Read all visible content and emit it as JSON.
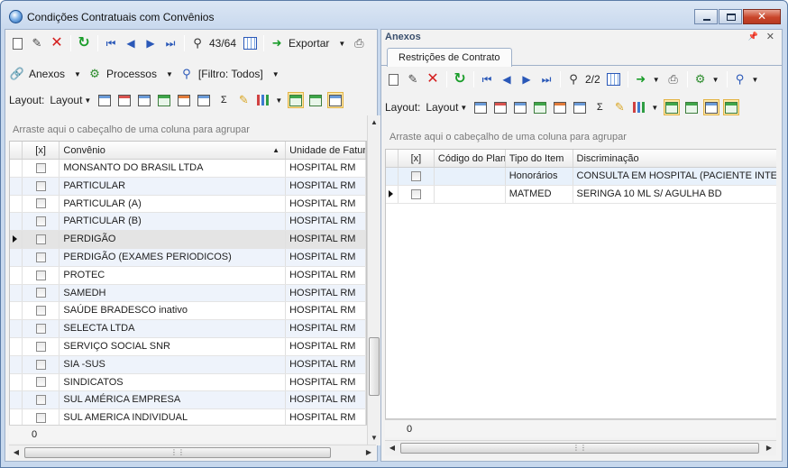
{
  "window": {
    "title": "Condições Contratuais com Convênios",
    "close_glyph": "✕"
  },
  "left": {
    "toolbar1": {
      "record_position": "43/64",
      "export_label": "Exportar"
    },
    "toolbar2": {
      "anexos_label": "Anexos",
      "processos_label": "Processos",
      "filter_label": "[Filtro: Todos]"
    },
    "toolbar3": {
      "layout_label": "Layout:",
      "layout_menu": "Layout"
    },
    "group_hint": "Arraste aqui o cabeçalho de uma coluna para agrupar",
    "columns": {
      "check": "[x]",
      "convenio": "Convênio",
      "unidade": "Unidade de Fatura"
    },
    "rows": [
      {
        "convenio": "MONSANTO DO BRASIL LTDA",
        "unidade": "HOSPITAL RM"
      },
      {
        "convenio": "PARTICULAR",
        "unidade": "HOSPITAL RM"
      },
      {
        "convenio": "PARTICULAR (A)",
        "unidade": "HOSPITAL RM"
      },
      {
        "convenio": "PARTICULAR (B)",
        "unidade": "HOSPITAL RM"
      },
      {
        "convenio": "PERDIGÃO",
        "unidade": "HOSPITAL RM"
      },
      {
        "convenio": "PERDIGÃO (EXAMES PERIODICOS)",
        "unidade": "HOSPITAL RM"
      },
      {
        "convenio": "PROTEC",
        "unidade": "HOSPITAL RM"
      },
      {
        "convenio": "SAMEDH",
        "unidade": "HOSPITAL RM"
      },
      {
        "convenio": "SAÚDE BRADESCO inativo",
        "unidade": "HOSPITAL RM"
      },
      {
        "convenio": "SELECTA LTDA",
        "unidade": "HOSPITAL RM"
      },
      {
        "convenio": "SERVIÇO SOCIAL SNR",
        "unidade": "HOSPITAL RM"
      },
      {
        "convenio": "SIA -SUS",
        "unidade": "HOSPITAL RM"
      },
      {
        "convenio": "SINDICATOS",
        "unidade": "HOSPITAL RM"
      },
      {
        "convenio": "SUL AMÉRICA EMPRESA",
        "unidade": "HOSPITAL RM"
      },
      {
        "convenio": "SUL AMERICA INDIVIDUAL",
        "unidade": "HOSPITAL RM"
      }
    ],
    "footer_count": "0"
  },
  "right": {
    "panel_title": "Anexos",
    "pin_glyph": "📌",
    "close_glyph": "✕",
    "tab_label": "Restrições de Contrato",
    "toolbar1": {
      "record_position": "2/2"
    },
    "toolbar2": {
      "layout_label": "Layout:",
      "layout_menu": "Layout"
    },
    "group_hint": "Arraste aqui o cabeçalho de uma coluna para agrupar",
    "columns": {
      "check": "[x]",
      "codigo": "Código do Plano",
      "tipo": "Tipo do Item",
      "discriminacao": "Discriminação"
    },
    "rows": [
      {
        "codigo": "",
        "tipo": "Honorários",
        "discriminacao": "CONSULTA EM HOSPITAL (PACIENTE INTERNADO)"
      },
      {
        "codigo": "",
        "tipo": "MATMED",
        "discriminacao": "SERINGA 10 ML S/ AGULHA BD"
      }
    ],
    "footer_count": "0"
  },
  "icons": {
    "new": "new-document-icon",
    "edit": "edit-icon",
    "delete": "delete-icon",
    "refresh": "refresh-icon",
    "first": "first-record-icon",
    "prev": "previous-record-icon",
    "next": "next-record-icon",
    "last": "last-record-icon",
    "find": "binoculars-icon",
    "calendar": "calendar-icon",
    "export": "export-icon",
    "print": "printer-icon"
  },
  "colors": {
    "title_gradient": "#c9d9ee",
    "alt_row": "#eef3fb",
    "delete_red": "#d41e1e",
    "refresh_green": "#1a9d2a"
  }
}
